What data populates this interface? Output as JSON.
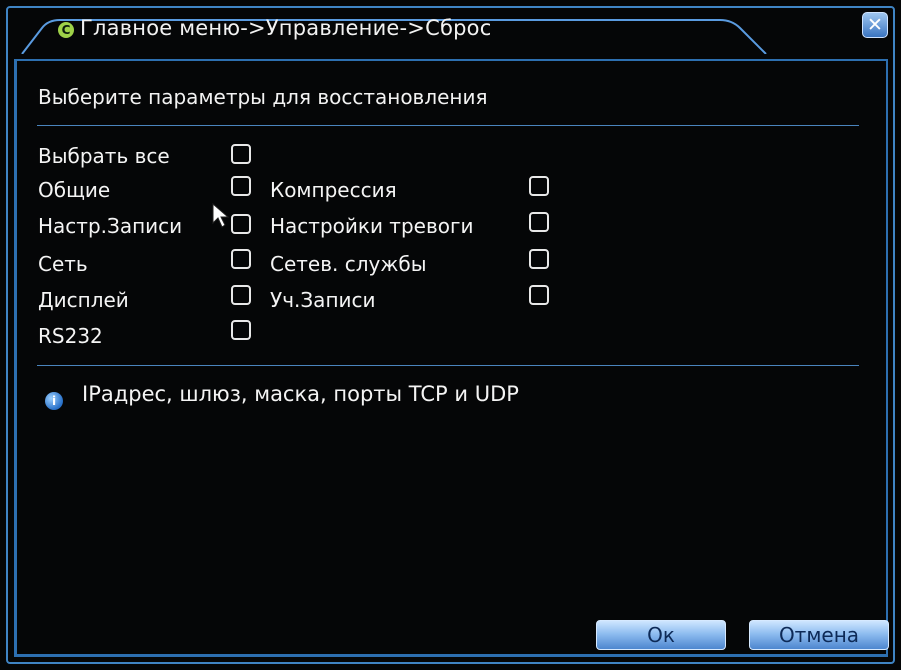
{
  "window": {
    "title": "Главное меню->Управление->Сброс",
    "logo_letter": "C",
    "close_label": "✕"
  },
  "heading": "Выберите параметры для восстановления",
  "options": {
    "select_all": "Выбрать все",
    "general": "Общие",
    "compression": "Компрессия",
    "record_settings": "Настр.Записи",
    "alarm_settings": "Настройки тревоги",
    "network": "Сеть",
    "network_services": "Сетев. службы",
    "display": "Дисплей",
    "account": "Уч.Записи",
    "rs232": "RS232"
  },
  "info": {
    "icon": "info-icon",
    "text": "IPадрес, шлюз, маска, порты TCP и UDP"
  },
  "buttons": {
    "ok": "Ок",
    "cancel": "Отмена"
  },
  "colors": {
    "frame": "#3f84c4",
    "button": "#8fbdf0",
    "background": "#050607"
  }
}
